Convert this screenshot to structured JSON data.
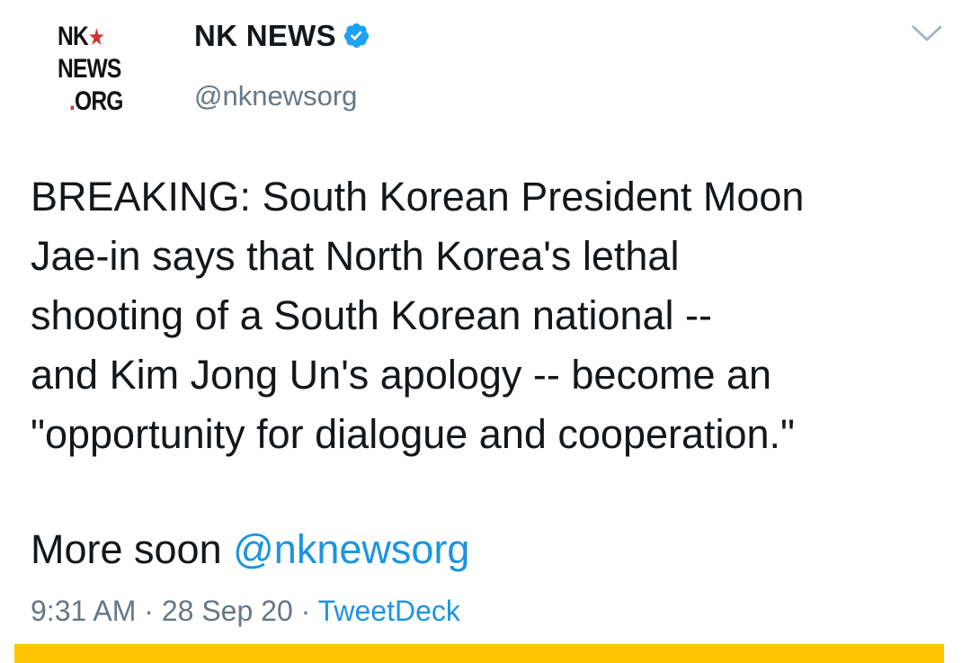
{
  "tweet": {
    "avatar": {
      "line1": "NK",
      "star": "★",
      "line2": "NEWS",
      "line3_dot": ".",
      "line3": "ORG",
      "star_color": "#d32f2f"
    },
    "author_name": "NK NEWS",
    "verified": true,
    "handle": "@nknewsorg",
    "menu_icon": "chevron-down-icon",
    "text": "BREAKING: South Korean President Moon\nJae-in says that North Korea's lethal\nshooting of a South Korean national --\nand Kim Jong Un's apology -- become an\n\"opportunity for dialogue and cooperation.\"",
    "more_prefix": "More soon ",
    "more_mention": "@nknewsorg",
    "time": "9:31 AM",
    "separator1": " · ",
    "date": "28 Sep 20",
    "separator2": " · ",
    "source": "TweetDeck"
  },
  "colors": {
    "link": "#1b95e0",
    "muted": "#657786",
    "verified": "#1da1f2",
    "bar": "#ffc500"
  }
}
